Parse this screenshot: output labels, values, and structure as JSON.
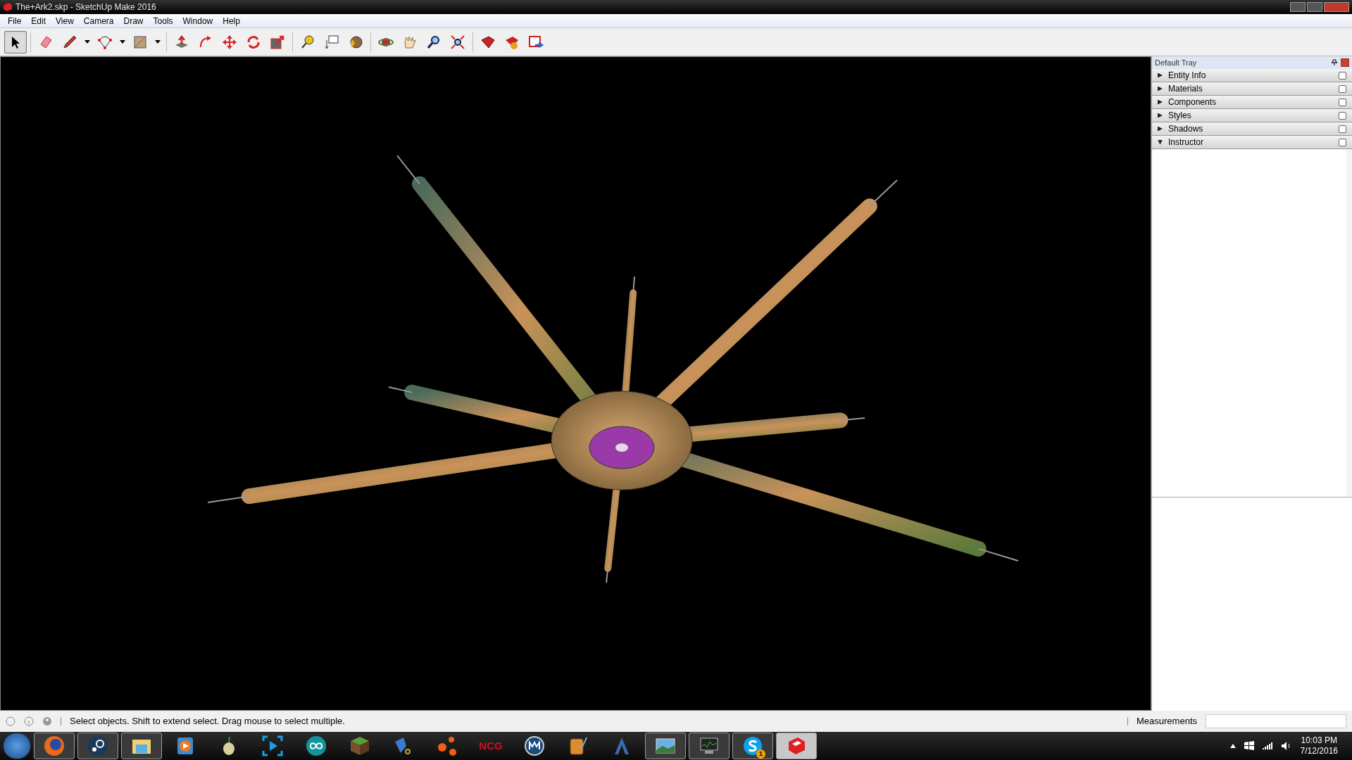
{
  "window": {
    "title": "The+Ark2.skp - SketchUp Make 2016"
  },
  "menu": [
    "File",
    "Edit",
    "View",
    "Camera",
    "Draw",
    "Tools",
    "Window",
    "Help"
  ],
  "toolbar": [
    {
      "selected": true
    },
    {
      "selected": false
    },
    {
      "selected": false
    },
    {
      "selected": false
    },
    {
      "selected": false
    },
    {
      "selected": false
    },
    {
      "selected": false
    },
    {
      "selected": false
    },
    {
      "selected": false
    },
    {
      "selected": false
    },
    {
      "selected": false
    },
    {
      "selected": false
    },
    {
      "selected": false
    },
    {
      "selected": false
    },
    {
      "selected": false
    },
    {
      "selected": false
    },
    {
      "selected": false
    },
    {
      "selected": false
    },
    {
      "selected": false
    },
    {
      "selected": false
    }
  ],
  "tray": {
    "title": "Default Tray",
    "panels": [
      {
        "label": "Entity Info",
        "expanded": false
      },
      {
        "label": "Materials",
        "expanded": false
      },
      {
        "label": "Components",
        "expanded": false
      },
      {
        "label": "Styles",
        "expanded": false
      },
      {
        "label": "Shadows",
        "expanded": false
      },
      {
        "label": "Instructor",
        "expanded": true
      }
    ]
  },
  "status_bar": {
    "message": "Select objects. Shift to extend select. Drag mouse to select multiple.",
    "measurements_label": "Measurements"
  },
  "taskbar": {
    "items": [
      {
        "running": true,
        "selected": false
      },
      {
        "running": true,
        "selected": false
      },
      {
        "running": true,
        "selected": false
      },
      {
        "running": false,
        "selected": false
      },
      {
        "running": false,
        "selected": false
      },
      {
        "running": false,
        "selected": false
      },
      {
        "running": false,
        "selected": false
      },
      {
        "running": false,
        "selected": false
      },
      {
        "running": false,
        "selected": false
      },
      {
        "running": false,
        "selected": false
      },
      {
        "running": false,
        "selected": false,
        "label": "NCG"
      },
      {
        "running": false,
        "selected": false
      },
      {
        "running": false,
        "selected": false
      },
      {
        "running": false,
        "selected": false
      },
      {
        "running": true,
        "selected": false
      },
      {
        "running": true,
        "selected": false
      },
      {
        "running": true,
        "selected": false,
        "badge": "1"
      },
      {
        "running": true,
        "selected": true
      }
    ],
    "time": "10:03 PM",
    "date": "7/12/2016"
  }
}
